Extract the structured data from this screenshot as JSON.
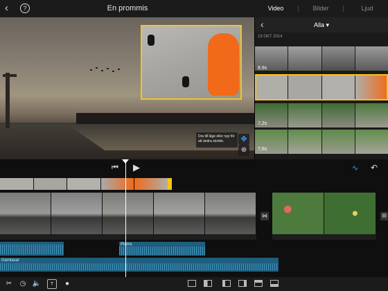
{
  "topbar": {
    "project_title": "En prommis",
    "tabs": [
      {
        "label": "Video",
        "active": true
      },
      {
        "label": "Bilder",
        "active": false
      },
      {
        "label": "Ljud",
        "active": false
      }
    ]
  },
  "viewer": {
    "hint_text": "Dra till läge eller nyp för att ändra storlek."
  },
  "browser": {
    "filter_label": "Alla ▾",
    "date_header": "19 OKT 2014",
    "clips": [
      {
        "duration": "8,9s"
      },
      {
        "duration": ""
      },
      {
        "duration": "7,2s"
      },
      {
        "duration": "7,6s"
      }
    ]
  },
  "timeline": {
    "audio_tracks": [
      {
        "label": "Plums"
      },
      {
        "label": "Gamlasar"
      }
    ]
  },
  "colors": {
    "accent": "#3aa0ff",
    "pip_border": "#f5c518",
    "audio_track": "#1e5e7f"
  }
}
